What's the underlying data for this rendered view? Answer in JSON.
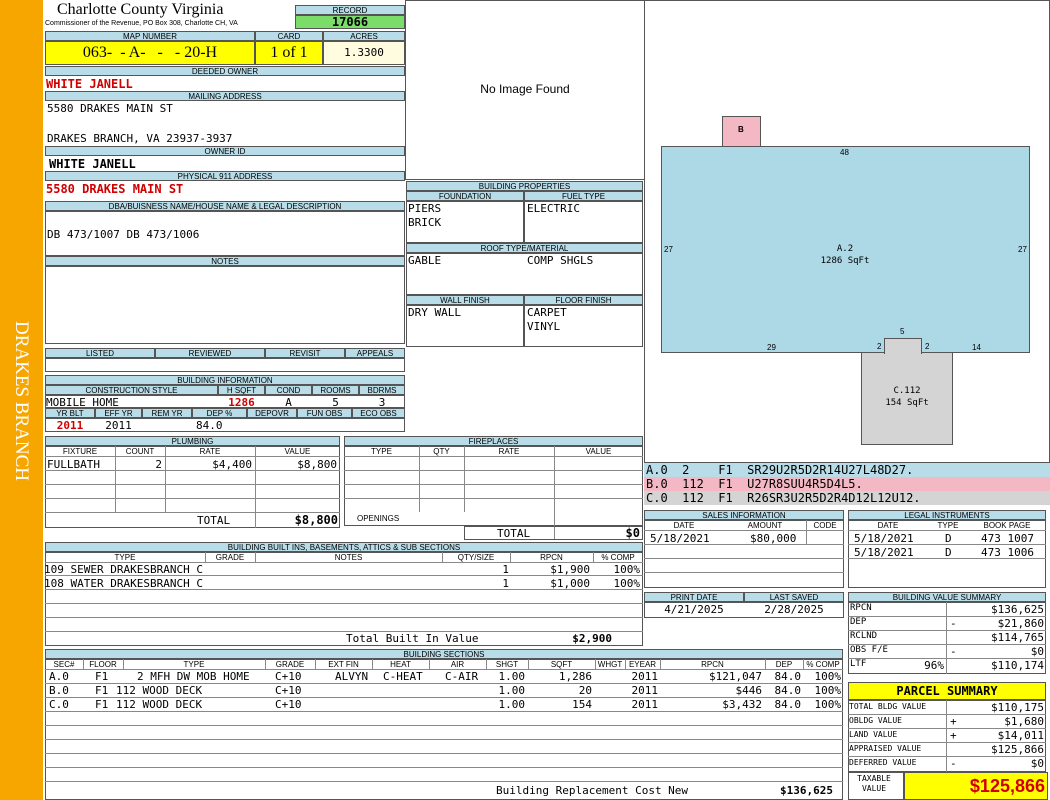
{
  "side_label": "DRAKES BRANCH",
  "county": {
    "title": "Charlotte County Virginia",
    "subtitle": "Commissioner of the Revenue, PO Box 308, Charlotte CH, VA"
  },
  "record": {
    "label": "RECORD",
    "value": "17066"
  },
  "map": {
    "label": "MAP NUMBER",
    "value": "063-  - A-   -   - 20-H"
  },
  "card": {
    "label": "CARD",
    "value": "1 of 1"
  },
  "acres": {
    "label": "ACRES",
    "value": "1.3300"
  },
  "owner": {
    "deeded_label": "DEEDED OWNER",
    "deeded": "WHITE JANELL",
    "mailing_label": "MAILING ADDRESS",
    "mail1": "5580 DRAKES MAIN ST",
    "mail2": "DRAKES BRANCH, VA 23937-3937",
    "id_label": "OWNER ID",
    "id": "WHITE JANELL",
    "phys_label": "PHYSICAL 911 ADDRESS",
    "phys": "5580 DRAKES MAIN ST"
  },
  "legal": {
    "label": "DBA/BUISNESS NAME/HOUSE NAME & LEGAL DESCRIPTION",
    "text": "DB 473/1007 DB 473/1006"
  },
  "notes": {
    "label": "NOTES"
  },
  "status": {
    "listed": "LISTED",
    "reviewed": "REVIEWED",
    "revisit": "REVISIT",
    "appeals": "APPEALS"
  },
  "bldg_info": {
    "label": "BUILDING INFORMATION",
    "style_label": "CONSTRUCTION STYLE",
    "style": "MOBILE HOME",
    "hsqft_label": "H SQFT",
    "hsqft": "1286",
    "cond_label": "COND",
    "cond": "A",
    "rooms_label": "ROOMS",
    "rooms": "5",
    "bdrms_label": "BDRMS",
    "bdrms": "3",
    "yrblt_label": "YR BLT",
    "yrblt": "2011",
    "effyr_label": "EFF YR",
    "effyr": "2011",
    "remyr_label": "REM YR",
    "remyr": "",
    "dep_label": "DEP %",
    "dep": "84.0",
    "depovr_label": "DEPOVR",
    "funobs_label": "FUN OBS",
    "ecoobs_label": "ECO OBS"
  },
  "plumbing": {
    "label": "PLUMBING",
    "cols": [
      "FIXTURE",
      "COUNT",
      "RATE",
      "VALUE"
    ],
    "row": {
      "fixture": "FULLBATH",
      "count": "2",
      "rate": "$4,400",
      "value": "$8,800"
    },
    "total_label": "TOTAL",
    "total": "$8,800"
  },
  "fireplaces": {
    "label": "FIREPLACES",
    "cols": [
      "TYPE",
      "QTY",
      "RATE",
      "VALUE"
    ],
    "openings": "OPENINGS",
    "total_label": "TOTAL",
    "total": "$0"
  },
  "builtins": {
    "label": "BUILDING BUILT INS, BASEMENTS, ATTICS & SUB SECTIONS",
    "cols": [
      "TYPE",
      "GRADE",
      "NOTES",
      "QTY/SIZE",
      "RPCN",
      "% COMP"
    ],
    "rows": [
      {
        "type": "109 SEWER DRAKESBRANCH C",
        "qty": "1",
        "rpcn": "$1,900",
        "comp": "100%"
      },
      {
        "type": "108 WATER DRAKESBRANCH C",
        "qty": "1",
        "rpcn": "$1,000",
        "comp": "100%"
      }
    ],
    "total_label": "Total Built In Value",
    "total": "$2,900"
  },
  "sections": {
    "label": "BUILDING SECTIONS",
    "cols": [
      "SEC#",
      "FLOOR",
      "TYPE",
      "GRADE",
      "EXT FIN",
      "HEAT",
      "AIR",
      "SHGT",
      "SQFT",
      "WHGT",
      "EYEAR",
      "RPCN",
      "DEP",
      "% COMP"
    ],
    "rows": [
      {
        "sec": "A.0",
        "floor": "F1",
        "type": "2 MFH DW MOB HOME",
        "grade": "C+10",
        "ext": "ALVYN",
        "heat": "C-HEAT",
        "air": "C-AIR",
        "shgt": "1.00",
        "sqft": "1,286",
        "eyear": "2011",
        "rpcn": "$121,047",
        "dep": "84.0",
        "comp": "100%"
      },
      {
        "sec": "B.0",
        "floor": "F1",
        "type": "112 WOOD DECK",
        "grade": "C+10",
        "ext": "",
        "heat": "",
        "air": "",
        "shgt": "1.00",
        "sqft": "20",
        "eyear": "2011",
        "rpcn": "$446",
        "dep": "84.0",
        "comp": "100%"
      },
      {
        "sec": "C.0",
        "floor": "F1",
        "type": "112 WOOD DECK",
        "grade": "C+10",
        "ext": "",
        "heat": "",
        "air": "",
        "shgt": "1.00",
        "sqft": "154",
        "eyear": "2011",
        "rpcn": "$3,432",
        "dep": "84.0",
        "comp": "100%"
      }
    ],
    "total_label": "Building Replacement Cost New",
    "total": "$136,625"
  },
  "image": {
    "text": "No Image Found"
  },
  "props": {
    "label": "BUILDING PROPERTIES",
    "foundation_label": "FOUNDATION",
    "foundation": [
      "PIERS",
      "BRICK"
    ],
    "fuel_label": "FUEL TYPE",
    "fuel": "ELECTRIC",
    "roof_label": "ROOF TYPE/MATERIAL",
    "roof_type": "GABLE",
    "roof_mat": "COMP SHGLS",
    "wall_label": "WALL FINISH",
    "wall": "DRY WALL",
    "floor_label": "FLOOR FINISH",
    "floor": [
      "CARPET",
      "VINYL"
    ]
  },
  "sketch": {
    "b_label": "B",
    "a_label": "A.2",
    "a_area": "1286 SqFt",
    "c_label": "C.112",
    "c_area": "154 SqFt",
    "top": "48",
    "left": "27",
    "right": "27",
    "bl": "29",
    "br": "14",
    "n5": "5",
    "n2a": "2",
    "n2b": "2"
  },
  "sketch_codes": [
    {
      "text": "A.0  2    F1  SR29U2R5D2R14U27L48D27.",
      "bg": "#b9dde8"
    },
    {
      "text": "B.0  112  F1  U27R8SUU4R5D4L5.",
      "bg": "#f4b8c4"
    },
    {
      "text": "C.0  112  F1  R26SR3U2R5D2R4D12L12U12.",
      "bg": "#d4d4d4"
    }
  ],
  "sales": {
    "label": "SALES INFORMATION",
    "cols": [
      "DATE",
      "AMOUNT",
      "CODE"
    ],
    "date": "5/18/2021",
    "amount": "$80,000",
    "code": ""
  },
  "legal_inst": {
    "label": "LEGAL INSTRUMENTS",
    "cols": [
      "DATE",
      "TYPE",
      "BOOK PAGE"
    ],
    "rows": [
      {
        "date": "5/18/2021",
        "type": "D",
        "book": "473 1007"
      },
      {
        "date": "5/18/2021",
        "type": "D",
        "book": "473 1006"
      }
    ]
  },
  "dates": {
    "print_label": "PRINT DATE",
    "print": "4/21/2025",
    "saved_label": "LAST SAVED",
    "saved": "2/28/2025"
  },
  "value_summary": {
    "label": "BUILDING VALUE SUMMARY",
    "rows": [
      {
        "l": "RPCN",
        "pct": "",
        "s": "",
        "v": "$136,625"
      },
      {
        "l": "DEP",
        "pct": "",
        "s": "-",
        "v": "$21,860"
      },
      {
        "l": "RCLND",
        "pct": "",
        "s": "",
        "v": "$114,765"
      },
      {
        "l": "OBS F/E",
        "pct": "",
        "s": "-",
        "v": "$0"
      },
      {
        "l": "LTF",
        "pct": "96%",
        "s": "",
        "v": "$110,174"
      }
    ]
  },
  "parcel": {
    "label": "PARCEL SUMMARY",
    "rows": [
      {
        "l": "TOTAL BLDG VALUE",
        "s": "",
        "v": "$110,175"
      },
      {
        "l": "OBLDG VALUE",
        "s": "+",
        "v": "$1,680"
      },
      {
        "l": "LAND VALUE",
        "s": "+",
        "v": "$14,011"
      },
      {
        "l": "APPRAISED VALUE",
        "s": "",
        "v": "$125,866"
      },
      {
        "l": "DEFERRED VALUE",
        "s": "-",
        "v": "$0"
      }
    ],
    "taxable_label": "TAXABLE VALUE",
    "taxable": "$125,866"
  },
  "colors": {
    "side": "#f7a600",
    "header": "#b9dde8",
    "record": "#7bdc6a",
    "yellow": "#ffff00",
    "red": "#d10000",
    "sketch": "#add8e6",
    "deck_b": "#f4b8c4",
    "deck_c": "#d4d4d4"
  }
}
